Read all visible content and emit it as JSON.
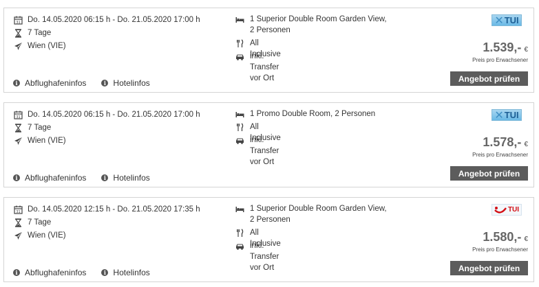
{
  "offers": [
    {
      "date_range": "Do. 14.05.2020 06:15 h - Do. 21.05.2020 17:00 h",
      "duration": "7 Tage",
      "departure": "Wien (VIE)",
      "room": "1 Superior Double Room Garden View, 2 Personen",
      "board": "All Inclusive",
      "transfer": "inkl. Transfer vor Ort",
      "airport_info_label": "Abflughafeninfos",
      "hotel_info_label": "Hotelinfos",
      "operator_logo": "TUI",
      "operator_logo_style": "xtui-blue",
      "price": "1.539,-",
      "currency": "€",
      "price_note": "Preis pro Erwachsener",
      "cta_label": "Angebot prüfen"
    },
    {
      "date_range": "Do. 14.05.2020 06:15 h - Do. 21.05.2020 17:00 h",
      "duration": "7 Tage",
      "departure": "Wien (VIE)",
      "room": "1 Promo Double Room, 2 Personen",
      "board": "All Inclusive",
      "transfer": "inkl. Transfer vor Ort",
      "airport_info_label": "Abflughafeninfos",
      "hotel_info_label": "Hotelinfos",
      "operator_logo": "TUI",
      "operator_logo_style": "xtui-blue",
      "price": "1.578,-",
      "currency": "€",
      "price_note": "Preis pro Erwachsener",
      "cta_label": "Angebot prüfen"
    },
    {
      "date_range": "Do. 14.05.2020 12:15 h - Do. 21.05.2020 17:35 h",
      "duration": "7 Tage",
      "departure": "Wien (VIE)",
      "room": "1 Superior Double Room Garden View, 2 Personen",
      "board": "All Inclusive",
      "transfer": "inkl. Transfer vor Ort",
      "airport_info_label": "Abflughafeninfos",
      "hotel_info_label": "Hotelinfos",
      "operator_logo": "TUI",
      "operator_logo_style": "tui-red",
      "price": "1.580,-",
      "currency": "€",
      "price_note": "Preis pro Erwachsener",
      "cta_label": "Angebot prüfen"
    }
  ],
  "colors": {
    "button_bg": "#5c5c5c",
    "border": "#d4d4d4",
    "price_text": "#666666",
    "tui_blue": "#1d5f95",
    "tui_red": "#d40e14"
  },
  "icons": [
    "calendar-icon",
    "hourglass-icon",
    "plane-icon",
    "bed-icon",
    "cutlery-icon",
    "car-icon",
    "info-icon"
  ]
}
